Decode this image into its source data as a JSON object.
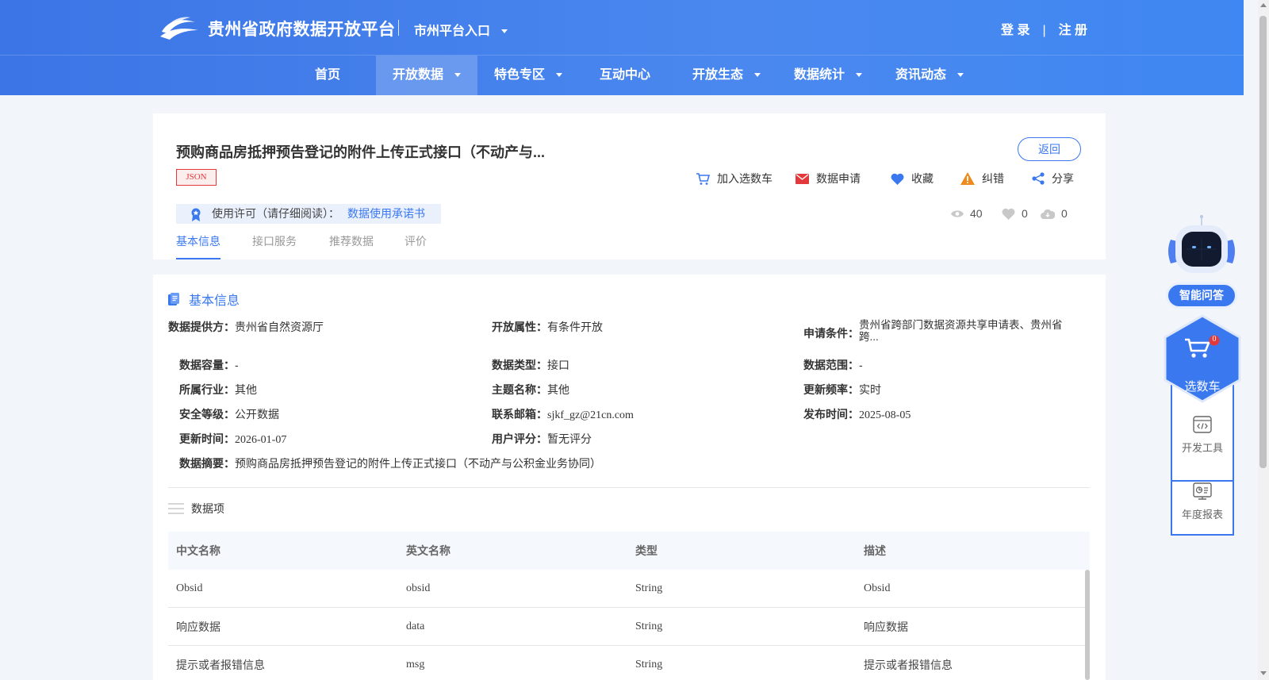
{
  "header": {
    "site_title": "贵州省政府数据开放平台",
    "city_entry": "市州平台入口",
    "login": "登 录",
    "separator": "|",
    "register": "注 册"
  },
  "nav": {
    "items": [
      {
        "label": "首页"
      },
      {
        "label": "开放数据"
      },
      {
        "label": "特色专区"
      },
      {
        "label": "互动中心"
      },
      {
        "label": "开放生态"
      },
      {
        "label": "数据统计"
      },
      {
        "label": "资讯动态"
      }
    ],
    "active": "开放数据"
  },
  "dataset": {
    "title": "预购商品房抵押预告登记的附件上传正式接口（不动产与...",
    "back": "返回",
    "format_tag": "JSON",
    "actions": {
      "cart": "加入选数车",
      "apply": "数据申请",
      "favorite": "收藏",
      "correct": "纠错",
      "share": "分享"
    },
    "license_label": "使用许可（请仔细阅读）：",
    "license_link": "数据使用承诺书",
    "stats": {
      "views": "40",
      "likes": "0",
      "downloads": "0"
    },
    "tabs": [
      "基本信息",
      "接口服务",
      "推荐数据",
      "评价"
    ]
  },
  "basic_info": {
    "section_title": "基本信息",
    "fields": {
      "provider": {
        "label": "数据提供方：",
        "value": "贵州省自然资源厅"
      },
      "open_attr": {
        "label": "开放属性：",
        "value": "有条件开放"
      },
      "apply_cond": {
        "label": "申请条件：",
        "value": "贵州省跨部门数据资源共享申请表、贵州省",
        "value2": "跨..."
      },
      "capacity": {
        "label": "数据容量：",
        "value": "-"
      },
      "data_type": {
        "label": "数据类型：",
        "value": "接口"
      },
      "data_range": {
        "label": "数据范围：",
        "value": "-"
      },
      "industry": {
        "label": "所属行业：",
        "value": "其他"
      },
      "theme": {
        "label": "主题名称：",
        "value": "其他"
      },
      "frequency": {
        "label": "更新频率：",
        "value": "实时"
      },
      "security": {
        "label": "安全等级：",
        "value": "公开数据"
      },
      "email": {
        "label": "联系邮箱：",
        "value": "sjkf_gz@21cn.com"
      },
      "publish": {
        "label": "发布时间：",
        "value": "2025-08-05"
      },
      "update": {
        "label": "更新时间：",
        "value": "2026-01-07"
      },
      "rating": {
        "label": "用户评分：",
        "value": "暂无评分"
      },
      "summary": {
        "label": "数据摘要：",
        "value": "预购商品房抵押预告登记的附件上传正式接口（不动产与公积金业务协同）"
      }
    }
  },
  "data_items": {
    "title": "数据项",
    "columns": [
      "中文名称",
      "英文名称",
      "类型",
      "描述"
    ],
    "rows": [
      [
        "Obsid",
        "obsid",
        "String",
        "Obsid"
      ],
      [
        "响应数据",
        "data",
        "String",
        "响应数据"
      ],
      [
        "提示或者报错信息",
        "msg",
        "String",
        "提示或者报错信息"
      ]
    ]
  },
  "widgets": {
    "assistant": "智能问答",
    "cart": "选数车",
    "cart_count": "0",
    "dev_tools": "开发工具",
    "annual_report": "年度报表"
  },
  "colors": {
    "primary": "#3a78f0",
    "header_gradient_start": "#3c75e6",
    "header_gradient_end": "#3f87f2",
    "tag_red": "#e4393c",
    "page_bg": "#f2f5f9"
  },
  "icons": [
    "logo-icon",
    "cart-icon",
    "mail-icon",
    "heart-icon",
    "warning-icon",
    "share-icon",
    "ribbon-icon",
    "eye-icon",
    "cloud-icon",
    "doc-icon",
    "list-icon",
    "robot-icon",
    "code-icon",
    "report-icon"
  ]
}
